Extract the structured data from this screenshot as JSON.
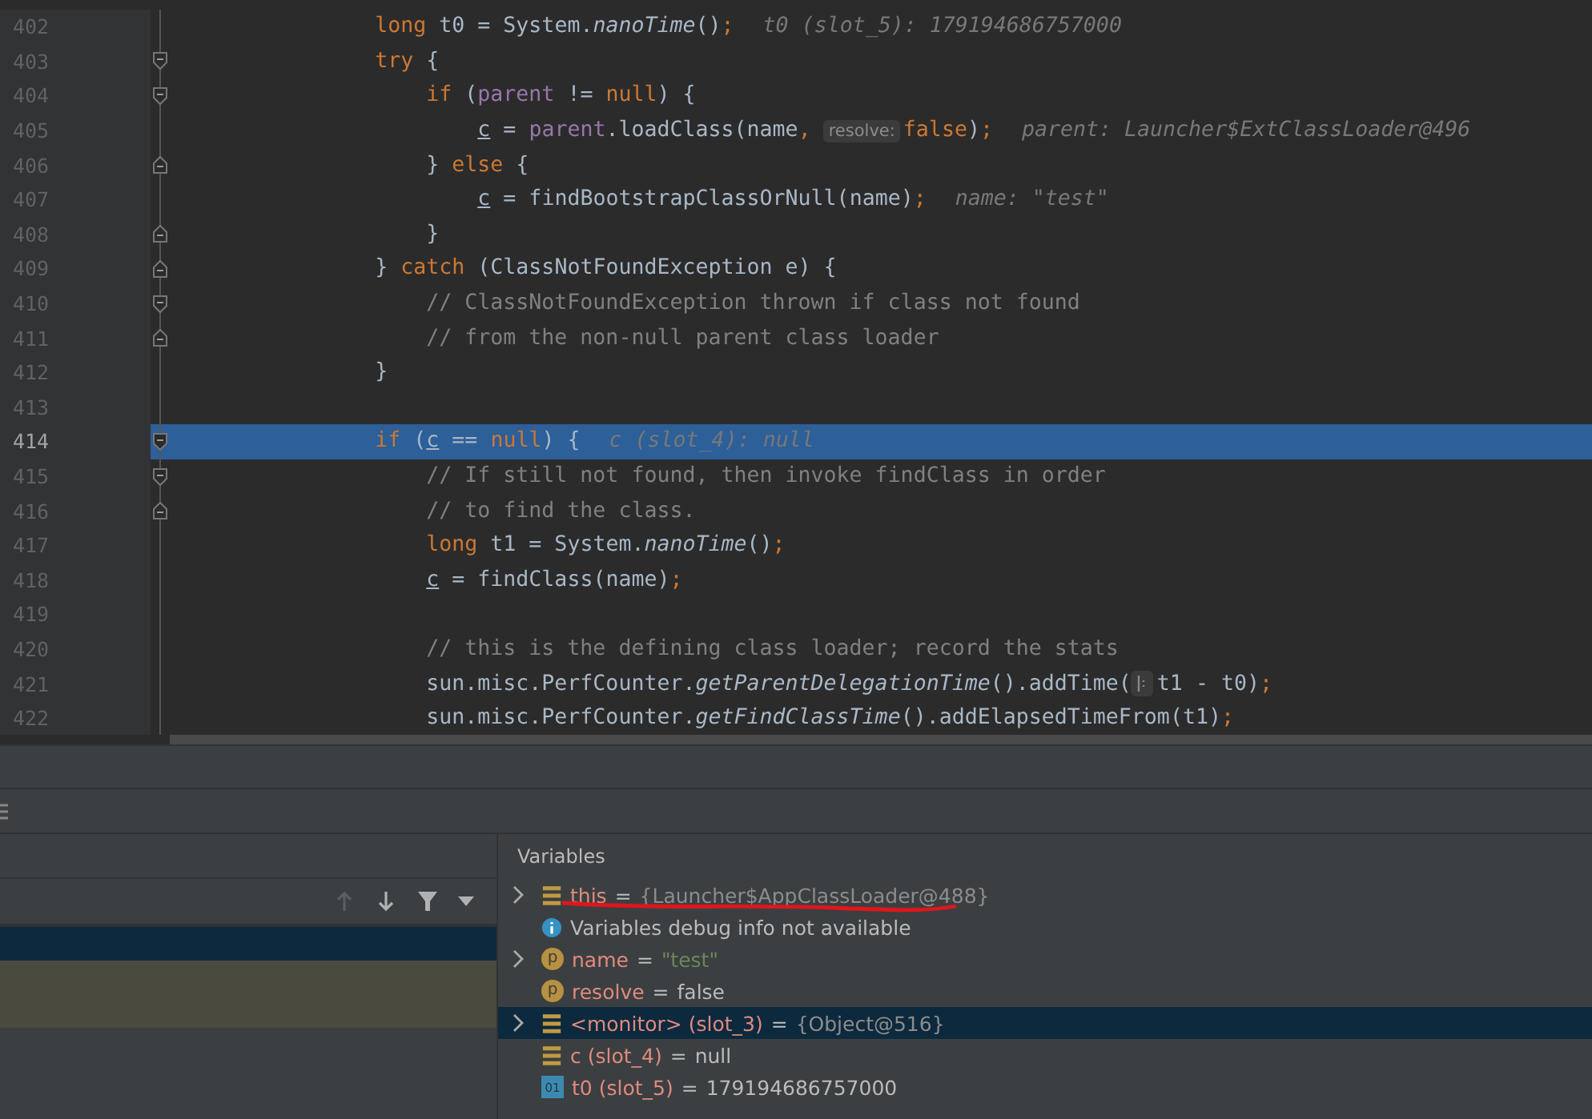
{
  "editor": {
    "lines": [
      {
        "number": "402",
        "current": false,
        "fold_start": false,
        "fold_end": false,
        "tokens": [
          {
            "kind": "kw",
            "t": "                long"
          },
          {
            "kind": "plain",
            "t": " t0 = System."
          },
          {
            "kind": "method",
            "t": "nanoTime"
          },
          {
            "kind": "plain",
            "t": "()"
          },
          {
            "kind": "kw",
            "t": ";"
          },
          {
            "kind": "hint",
            "t": "t0 (slot_5): 179194686757000"
          }
        ]
      },
      {
        "number": "403",
        "current": false,
        "fold_start": true,
        "fold_end": false,
        "tokens": [
          {
            "kind": "kw",
            "t": "                try"
          },
          {
            "kind": "plain",
            "t": " {"
          }
        ]
      },
      {
        "number": "404",
        "current": false,
        "fold_start": true,
        "fold_end": false,
        "tokens": [
          {
            "kind": "kw",
            "t": "                    if"
          },
          {
            "kind": "plain",
            "t": " ("
          },
          {
            "kind": "field",
            "t": "parent"
          },
          {
            "kind": "plain",
            "t": " != "
          },
          {
            "kind": "kw",
            "t": "null"
          },
          {
            "kind": "plain",
            "t": ") {"
          }
        ]
      },
      {
        "number": "405",
        "current": false,
        "fold_start": false,
        "fold_end": false,
        "tokens": [
          {
            "kind": "var",
            "t": "                        c"
          },
          {
            "kind": "plain",
            "t": " = "
          },
          {
            "kind": "field",
            "t": "parent"
          },
          {
            "kind": "plain",
            "t": ".loadClass(name"
          },
          {
            "kind": "kw",
            "t": ", "
          },
          {
            "kind": "inlay",
            "t": "resolve:"
          },
          {
            "kind": "kw",
            "t": "false"
          },
          {
            "kind": "plain",
            "t": ")"
          },
          {
            "kind": "kw",
            "t": ";"
          },
          {
            "kind": "hint",
            "t": "parent: Launcher$ExtClassLoader@496"
          }
        ]
      },
      {
        "number": "406",
        "current": false,
        "fold_start": false,
        "fold_end": true,
        "tokens": [
          {
            "kind": "plain",
            "t": "                    } "
          },
          {
            "kind": "kw",
            "t": "else"
          },
          {
            "kind": "plain",
            "t": " {"
          }
        ]
      },
      {
        "number": "407",
        "current": false,
        "fold_start": false,
        "fold_end": false,
        "tokens": [
          {
            "kind": "var",
            "t": "                        c"
          },
          {
            "kind": "plain",
            "t": " = findBootstrapClassOrNull(name)"
          },
          {
            "kind": "kw",
            "t": ";"
          },
          {
            "kind": "hint",
            "t": "name: \"test\""
          }
        ]
      },
      {
        "number": "408",
        "current": false,
        "fold_start": false,
        "fold_end": true,
        "tokens": [
          {
            "kind": "plain",
            "t": "                    }"
          }
        ]
      },
      {
        "number": "409",
        "current": false,
        "fold_start": false,
        "fold_end": true,
        "tokens": [
          {
            "kind": "plain",
            "t": "                } "
          },
          {
            "kind": "kw",
            "t": "catch"
          },
          {
            "kind": "plain",
            "t": " (ClassNotFoundException e) {"
          }
        ]
      },
      {
        "number": "410",
        "current": false,
        "fold_start": true,
        "fold_end": false,
        "tokens": [
          {
            "kind": "comment",
            "t": "                    // ClassNotFoundException thrown if class not found"
          }
        ]
      },
      {
        "number": "411",
        "current": false,
        "fold_start": false,
        "fold_end": true,
        "tokens": [
          {
            "kind": "comment",
            "t": "                    // from the non-null parent class loader"
          }
        ]
      },
      {
        "number": "412",
        "current": false,
        "fold_start": false,
        "fold_end": false,
        "tokens": [
          {
            "kind": "plain",
            "t": "                }"
          }
        ]
      },
      {
        "number": "413",
        "current": false,
        "fold_start": false,
        "fold_end": false
      },
      {
        "number": "414",
        "current": true,
        "fold_start": true,
        "fold_end": false,
        "tokens": [
          {
            "kind": "kw",
            "t": "                if"
          },
          {
            "kind": "plain",
            "t": " ("
          },
          {
            "kind": "var",
            "t": "c"
          },
          {
            "kind": "plain",
            "t": " == "
          },
          {
            "kind": "kw",
            "t": "null"
          },
          {
            "kind": "plain",
            "t": ") {"
          },
          {
            "kind": "hint",
            "t": "c (slot_4): null"
          }
        ]
      },
      {
        "number": "415",
        "current": false,
        "fold_start": true,
        "fold_end": false,
        "tokens": [
          {
            "kind": "comment",
            "t": "                    // If still not found, then invoke findClass in order"
          }
        ]
      },
      {
        "number": "416",
        "current": false,
        "fold_start": false,
        "fold_end": true,
        "tokens": [
          {
            "kind": "comment",
            "t": "                    // to find the class."
          }
        ]
      },
      {
        "number": "417",
        "current": false,
        "fold_start": false,
        "fold_end": false,
        "tokens": [
          {
            "kind": "kw",
            "t": "                    long"
          },
          {
            "kind": "plain",
            "t": " t1 = System."
          },
          {
            "kind": "method",
            "t": "nanoTime"
          },
          {
            "kind": "plain",
            "t": "()"
          },
          {
            "kind": "kw",
            "t": ";"
          }
        ]
      },
      {
        "number": "418",
        "current": false,
        "fold_start": false,
        "fold_end": false,
        "tokens": [
          {
            "kind": "var",
            "t": "                    c"
          },
          {
            "kind": "plain",
            "t": " = findClass(name)"
          },
          {
            "kind": "kw",
            "t": ";"
          }
        ]
      },
      {
        "number": "419",
        "current": false,
        "fold_start": false,
        "fold_end": false
      },
      {
        "number": "420",
        "current": false,
        "fold_start": false,
        "fold_end": false,
        "tokens": [
          {
            "kind": "comment",
            "t": "                    // this is the defining class loader; record the stats"
          }
        ]
      },
      {
        "number": "421",
        "current": false,
        "fold_start": false,
        "fold_end": false,
        "tokens": [
          {
            "kind": "plain",
            "t": "                    sun.misc.PerfCounter."
          },
          {
            "kind": "method",
            "t": "getParentDelegationTime"
          },
          {
            "kind": "plain",
            "t": "().addTime("
          },
          {
            "kind": "inlay_icon"
          },
          {
            "kind": "plain",
            "t": "t1 - t0)"
          },
          {
            "kind": "kw",
            "t": ";"
          }
        ]
      },
      {
        "number": "422",
        "current": false,
        "fold_start": false,
        "fold_end": false,
        "tokens": [
          {
            "kind": "plain",
            "t": "                    sun.misc.PerfCounter."
          },
          {
            "kind": "method",
            "t": "getFindClassTime"
          },
          {
            "kind": "plain",
            "t": "().addElapsedTimeFrom(t1)"
          },
          {
            "kind": "kw",
            "t": ";"
          }
        ]
      }
    ]
  },
  "frames": {
    "toolbar": [
      {
        "kind": "up",
        "disabled": true
      },
      {
        "kind": "down",
        "disabled": false
      },
      {
        "kind": "filter",
        "disabled": false
      },
      {
        "kind": "dropdown",
        "disabled": false
      }
    ],
    "rows": [
      {
        "selected": true,
        "library": false
      },
      {
        "selected": false,
        "library": true
      },
      {
        "selected": false,
        "library": true
      }
    ]
  },
  "variables": {
    "title": "Variables",
    "rows": [
      {
        "kind": "field",
        "expandable": true,
        "name": "this",
        "separator": "=",
        "value": {
          "kind": "object",
          "text": "{Launcher$AppClassLoader@488}"
        },
        "selected": false,
        "underlined": true
      },
      {
        "kind": "message",
        "expandable": false,
        "text": "Variables debug info not available",
        "selected": false,
        "underlined": false
      },
      {
        "kind": "param",
        "expandable": true,
        "badge": "p",
        "name": "name",
        "separator": "=",
        "value": {
          "kind": "string",
          "text": "\"test\""
        },
        "selected": false,
        "underlined": false
      },
      {
        "kind": "param",
        "expandable": false,
        "badge": "p",
        "name": "resolve",
        "separator": "=",
        "value": {
          "kind": "plain",
          "text": "false"
        },
        "selected": false,
        "underlined": false
      },
      {
        "kind": "field",
        "expandable": true,
        "name": "<monitor> (slot_3)",
        "separator": "=",
        "value": {
          "kind": "object",
          "text": "{Object@516}"
        },
        "selected": true,
        "underlined": false
      },
      {
        "kind": "field",
        "expandable": false,
        "name": "c (slot_4)",
        "separator": "=",
        "value": {
          "kind": "plain",
          "text": "null"
        },
        "selected": false,
        "underlined": false
      },
      {
        "kind": "primitive",
        "expandable": false,
        "badge": "01",
        "name": "t0 (slot_5)",
        "separator": "=",
        "value": {
          "kind": "plain",
          "text": "179194686757000"
        },
        "selected": false,
        "underlined": false
      }
    ]
  }
}
